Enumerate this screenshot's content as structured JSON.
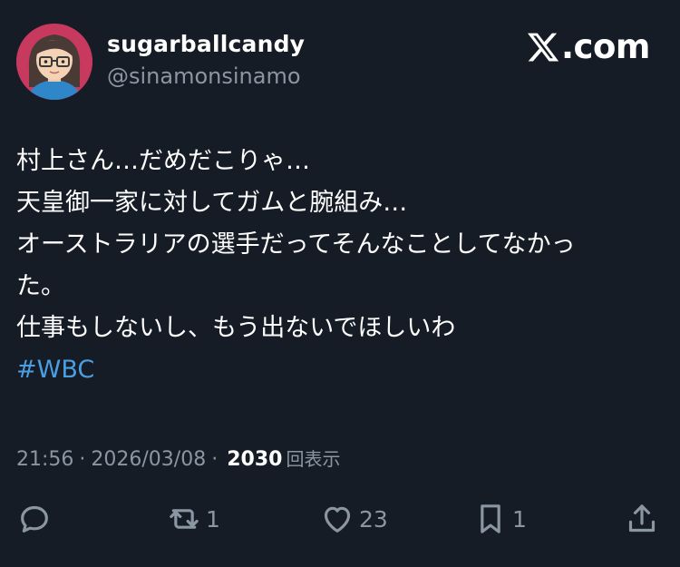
{
  "user": {
    "display_name": "sugarballcandy",
    "handle": "@sinamonsinamo",
    "avatar_icon": "avatar-illustration"
  },
  "brand": {
    "label": ".com",
    "icon": "x-logo-icon"
  },
  "tweet": {
    "lines": [
      "村上さん…だめだこりゃ…",
      "天皇御一家に対してガムと腕組み…",
      "オーストラリアの選手だってそんなことしてなかっ",
      "た。",
      "仕事もしないし、もう出ないでほしいわ"
    ],
    "hashtag": "#WBC"
  },
  "meta": {
    "time": "21:56",
    "date": "2026/03/08",
    "views_count": "2030",
    "views_label": "回表示",
    "separator": "·"
  },
  "actions": {
    "reply": {
      "icon": "reply-icon",
      "count": ""
    },
    "retweet": {
      "icon": "retweet-icon",
      "count": "1"
    },
    "like": {
      "icon": "heart-icon",
      "count": "23"
    },
    "bookmark": {
      "icon": "bookmark-icon",
      "count": "1"
    },
    "share": {
      "icon": "share-icon",
      "count": ""
    }
  },
  "colors": {
    "background": "#161c25",
    "text": "#ffffff",
    "muted": "#8b96a3",
    "link": "#4a9fe3",
    "avatar_ring": "#c7395e"
  }
}
